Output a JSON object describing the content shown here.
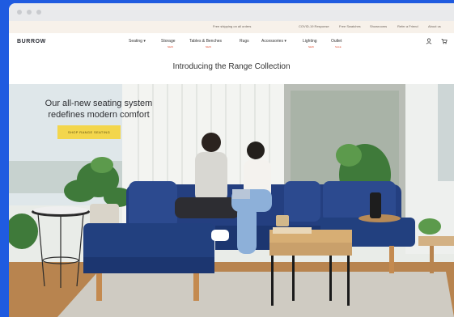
{
  "announcement": {
    "items": [
      "Free shipping on all orders",
      "COVID-19 Response",
      "Free Swatches",
      "Showrooms",
      "Refer a Friend",
      "About us"
    ]
  },
  "nav": {
    "logo": "BURROW",
    "items": [
      {
        "label": "Seating",
        "chevron": "▾",
        "sub": ""
      },
      {
        "label": "Storage",
        "chevron": "",
        "sub": "NEW"
      },
      {
        "label": "Tables & Benches",
        "chevron": "",
        "sub": "NEW"
      },
      {
        "label": "Rugs",
        "chevron": "",
        "sub": ""
      },
      {
        "label": "Accessories",
        "chevron": "▾",
        "sub": ""
      },
      {
        "label": "Lighting",
        "chevron": "",
        "sub": "NEW"
      },
      {
        "label": "Outlet",
        "chevron": "",
        "sub": "SALE"
      }
    ],
    "icons": [
      "account-icon",
      "cart-icon"
    ]
  },
  "subhead": {
    "title": "Introducing the Range Collection"
  },
  "hero": {
    "headline_line1": "Our all-new seating system",
    "headline_line2": "redefines modern comfort",
    "cta_label": "SHOP RANGE SEATING"
  },
  "colors": {
    "page_background": "#1f5be0",
    "sofa": "#243f80",
    "cta": "#f3d64c",
    "nav_badge": "#e0563d"
  }
}
